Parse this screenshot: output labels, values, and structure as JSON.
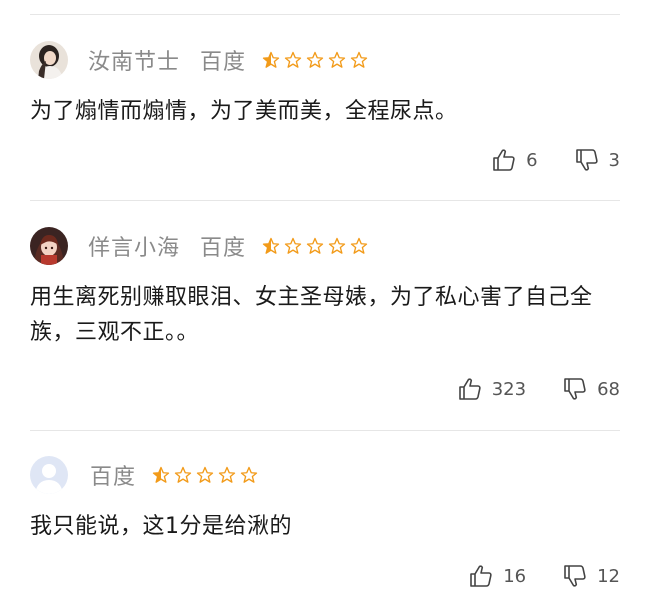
{
  "reviews": [
    {
      "username": "汝南节士",
      "source": "百度",
      "rating": 1,
      "max_rating": 5,
      "comment": "为了煽情而煽情，为了美而美，全程尿点。",
      "likes": "6",
      "dislikes": "3"
    },
    {
      "username": "佯言小海",
      "source": "百度",
      "rating": 1,
      "max_rating": 5,
      "comment": "用生离死别赚取眼泪、女主圣母婊，为了私心害了自己全族，三观不正。。",
      "likes": "323",
      "dislikes": "68"
    },
    {
      "username": "",
      "source": "百度",
      "rating": 1,
      "max_rating": 5,
      "comment": "我只能说，这1分是给湫的",
      "likes": "16",
      "dislikes": "12"
    }
  ],
  "colors": {
    "star_filled": "#f29b1a",
    "star_empty": "#f29b1a",
    "divider": "#e6e6e6",
    "meta_text": "#8a8a8a"
  }
}
